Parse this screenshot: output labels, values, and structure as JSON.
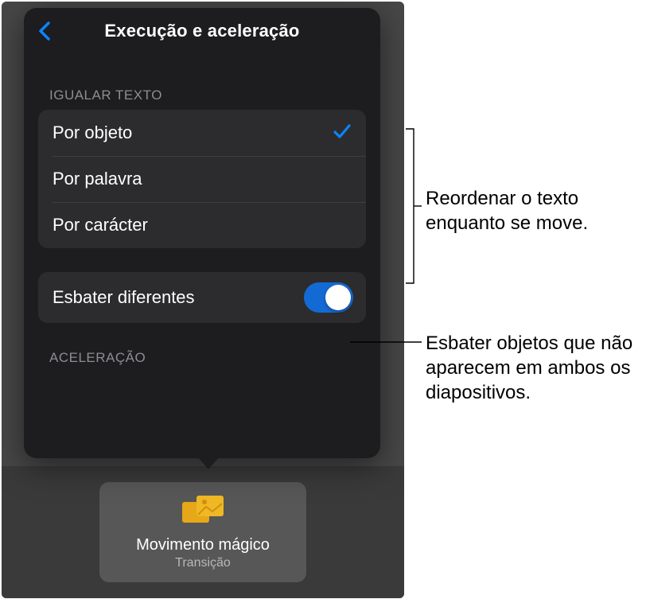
{
  "header": {
    "title": "Execução e aceleração"
  },
  "sections": {
    "match_text_header": "IGUALAR TEXTO",
    "acceleration_header": "ACELERAÇÃO"
  },
  "match_text_options": [
    {
      "label": "Por objeto",
      "selected": true
    },
    {
      "label": "Por palavra",
      "selected": false
    },
    {
      "label": "Por carácter",
      "selected": false
    }
  ],
  "fade": {
    "label": "Esbater diferentes",
    "on": true
  },
  "thumb": {
    "title": "Movimento mágico",
    "subtitle": "Transição"
  },
  "callouts": {
    "reorder": "Reordenar o texto enquanto se move.",
    "fade": "Esbater objetos que não aparecem em ambos os diapositivos."
  }
}
